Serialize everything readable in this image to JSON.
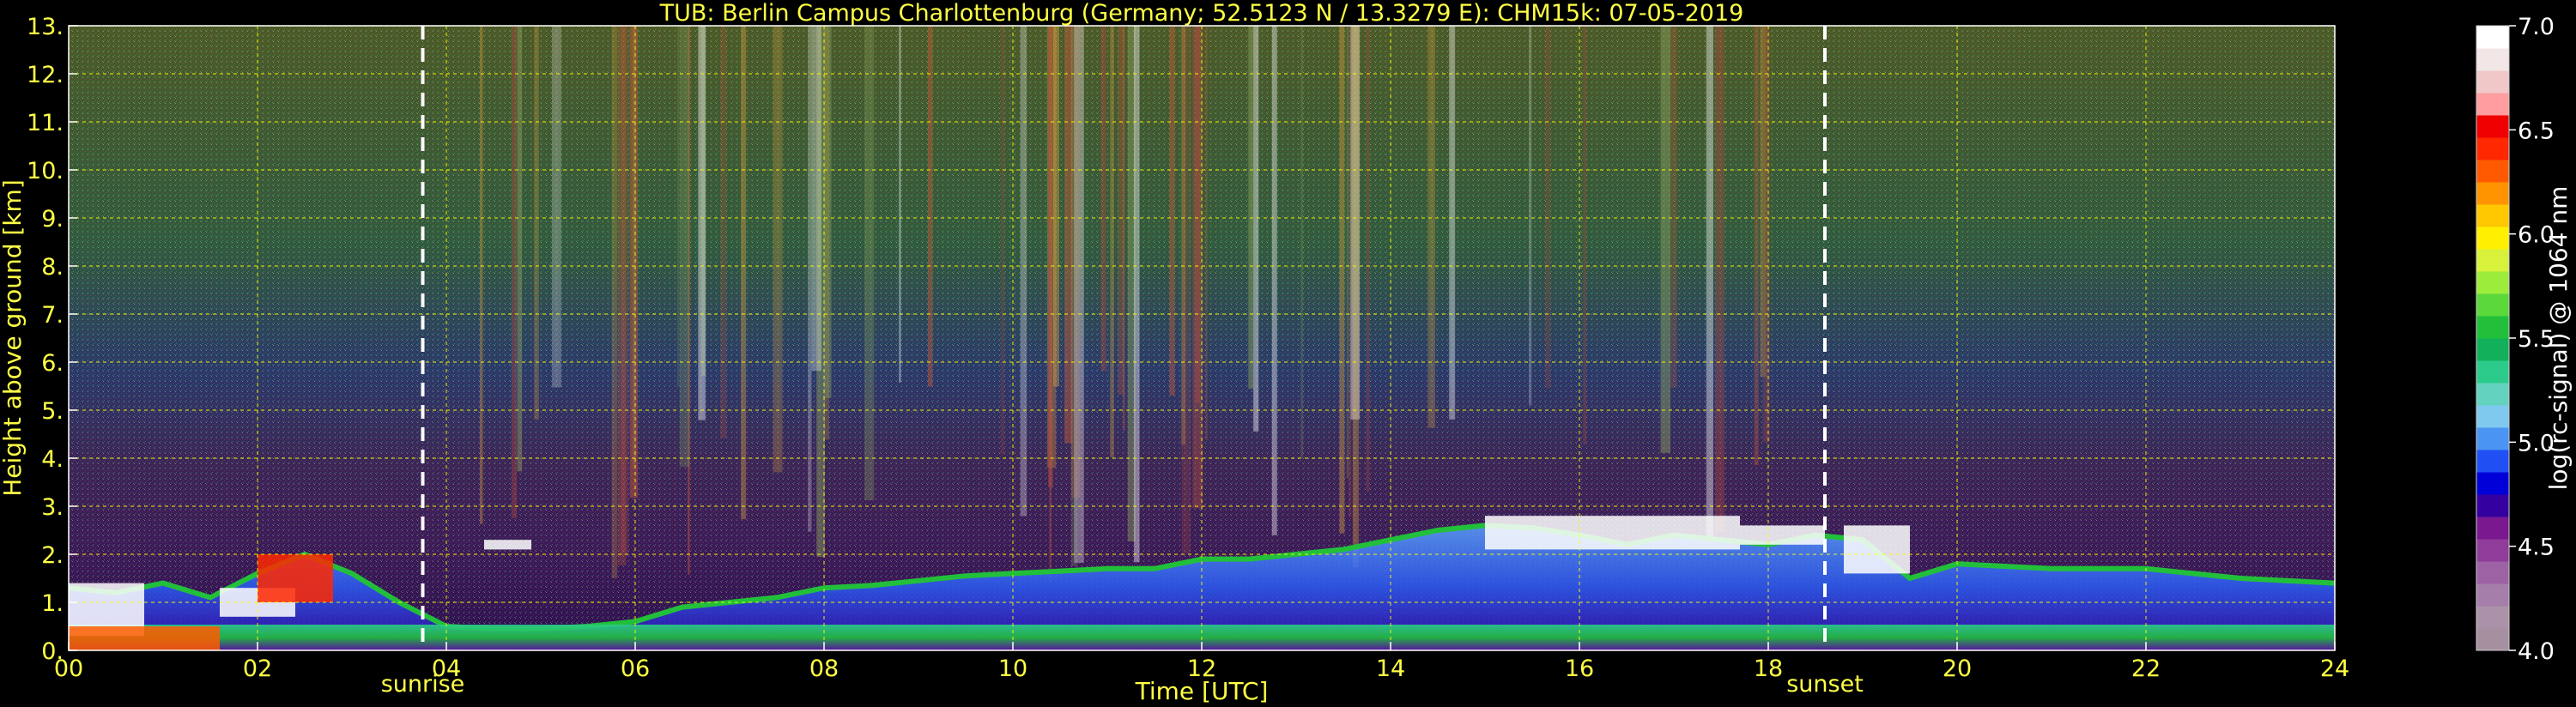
{
  "chart_data": {
    "type": "heatmap",
    "title": "TUB: Berlin Campus Charlottenburg (Germany; 52.5123 N / 13.3279 E):    CHM15k: 07-05-2019",
    "xlabel": "Time [UTC]",
    "ylabel": "Height above ground [km]",
    "xlim": [
      0,
      24
    ],
    "ylim": [
      0,
      13
    ],
    "x_ticks": [
      "00",
      "02",
      "04",
      "06",
      "08",
      "10",
      "12",
      "14",
      "16",
      "18",
      "20",
      "22",
      "24"
    ],
    "y_ticks": [
      "0.",
      "1.",
      "2.",
      "3.",
      "4.",
      "5.",
      "6.",
      "7.",
      "8.",
      "9.",
      "10.",
      "11.",
      "12.",
      "13."
    ],
    "grid": true,
    "events": [
      {
        "label": "sunrise",
        "time": 3.75
      },
      {
        "label": "sunset",
        "time": 18.6
      }
    ],
    "colorbar": {
      "label": "log(rc-signal) @ 1064 nm",
      "range": [
        4.0,
        7.0
      ],
      "ticks": [
        "4.0",
        "4.5",
        "5.0",
        "5.5",
        "6.0",
        "6.5",
        "7.0"
      ],
      "colors": [
        "#a6909f",
        "#ab92a8",
        "#a57ea9",
        "#9c62a3",
        "#8f3c9b",
        "#7a1890",
        "#3400a0",
        "#0000d8",
        "#2050f4",
        "#4a94f4",
        "#7fc8ee",
        "#63d3c0",
        "#2ccb8c",
        "#12b05a",
        "#22c03a",
        "#5bd83a",
        "#9cec3c",
        "#d8f23c",
        "#fff000",
        "#ffc800",
        "#ff9400",
        "#ff5a00",
        "#ff2800",
        "#f00000",
        "#ff9da0",
        "#f0c8c8",
        "#f2e6e6",
        "#ffffff"
      ]
    },
    "cloud_base_km": [
      [
        0.0,
        1.3
      ],
      [
        0.5,
        1.2
      ],
      [
        1.0,
        1.4
      ],
      [
        1.5,
        1.1
      ],
      [
        2.0,
        1.6
      ],
      [
        2.5,
        2.0
      ],
      [
        3.0,
        1.6
      ],
      [
        3.5,
        1.0
      ],
      [
        4.0,
        0.5
      ],
      [
        4.5,
        0.45
      ],
      [
        5.0,
        0.45
      ],
      [
        5.5,
        0.5
      ],
      [
        6.0,
        0.6
      ],
      [
        6.5,
        0.9
      ],
      [
        7.0,
        1.0
      ],
      [
        7.5,
        1.1
      ],
      [
        8.0,
        1.3
      ],
      [
        8.5,
        1.35
      ],
      [
        9.0,
        1.45
      ],
      [
        9.5,
        1.55
      ],
      [
        10.0,
        1.6
      ],
      [
        10.5,
        1.65
      ],
      [
        11.0,
        1.7
      ],
      [
        11.5,
        1.7
      ],
      [
        12.0,
        1.9
      ],
      [
        12.5,
        1.9
      ],
      [
        13.0,
        2.0
      ],
      [
        13.5,
        2.1
      ],
      [
        14.0,
        2.3
      ],
      [
        14.5,
        2.5
      ],
      [
        15.0,
        2.6
      ],
      [
        15.5,
        2.55
      ],
      [
        16.0,
        2.4
      ],
      [
        16.5,
        2.2
      ],
      [
        17.0,
        2.4
      ],
      [
        17.5,
        2.3
      ],
      [
        18.0,
        2.2
      ],
      [
        18.5,
        2.4
      ],
      [
        19.0,
        2.3
      ],
      [
        19.5,
        1.5
      ],
      [
        20.0,
        1.8
      ],
      [
        21.0,
        1.7
      ],
      [
        22.0,
        1.7
      ],
      [
        23.0,
        1.5
      ],
      [
        24.0,
        1.4
      ]
    ]
  }
}
